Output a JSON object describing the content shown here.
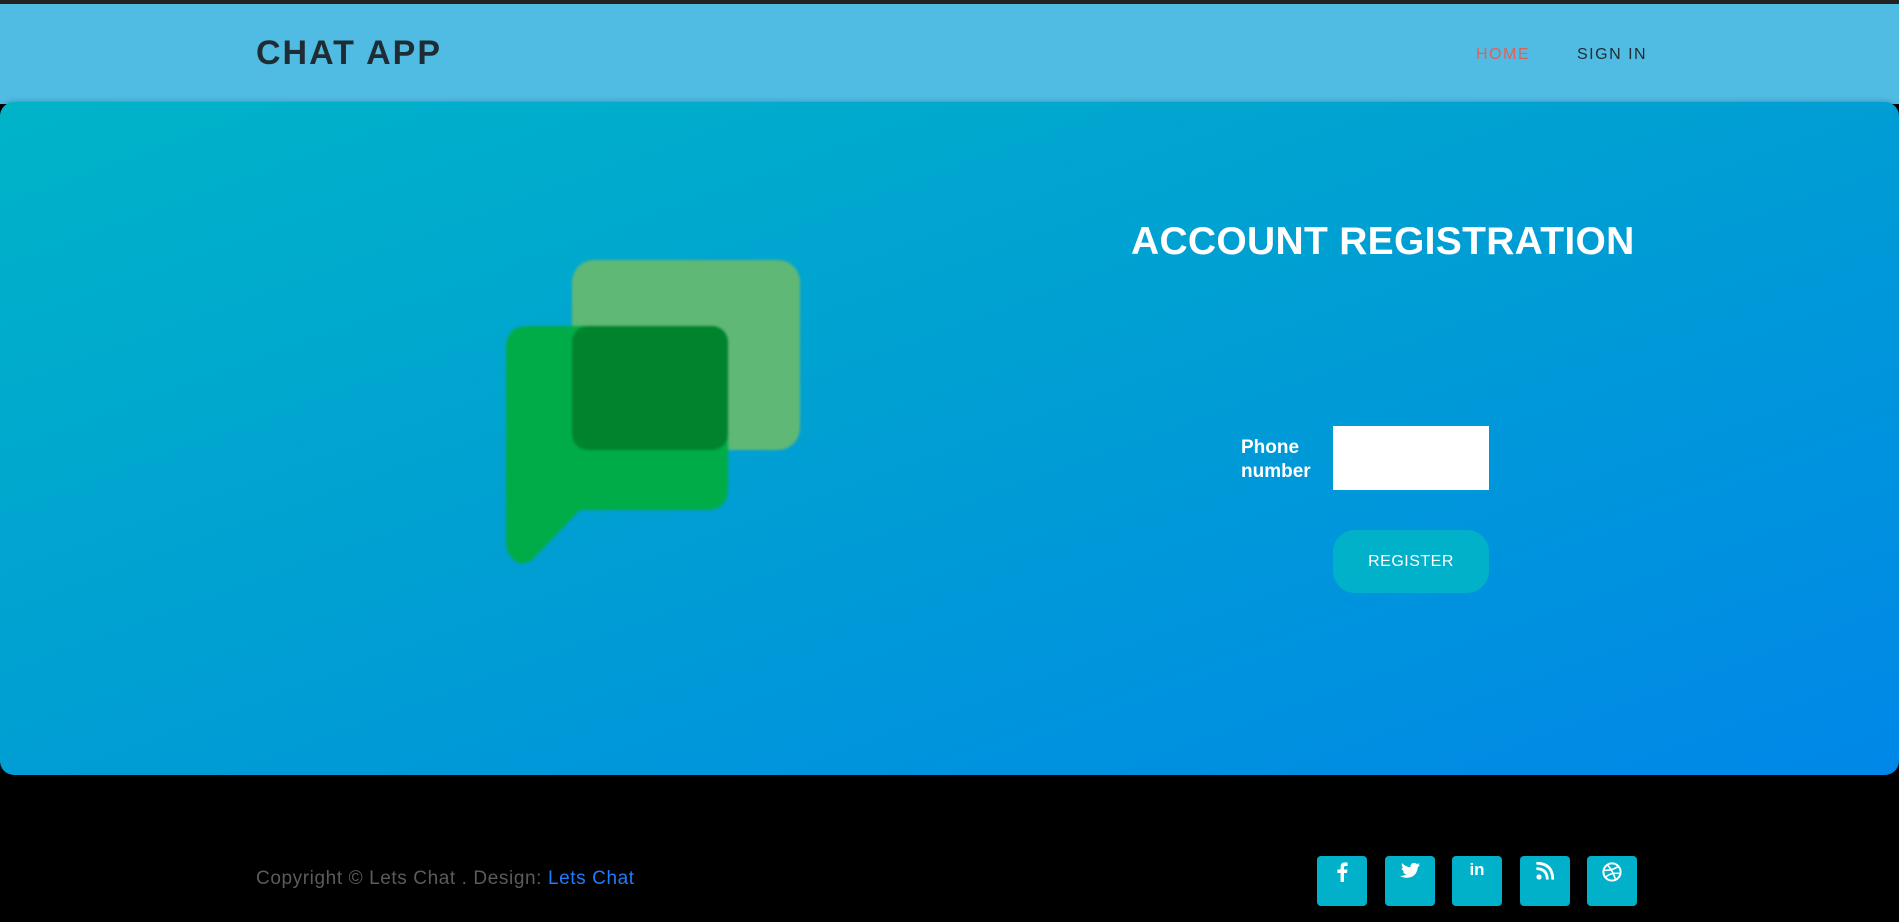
{
  "navbar": {
    "brand": "CHAT APP",
    "links": [
      {
        "label": "HOME",
        "active": true
      },
      {
        "label": "SIGN IN",
        "active": false
      }
    ]
  },
  "hero": {
    "logo": "chat-bubbles-logo",
    "registration_title": "ACCOUNT REGISTRATION",
    "phone_label": "Phone number",
    "phone_value": "",
    "register_label": "REGISTER"
  },
  "footer": {
    "copyright_text": "Copyright © Lets Chat . Design:",
    "design_link": "Lets Chat",
    "social_icons": [
      "facebook-icon",
      "twitter-icon",
      "linkedin-icon",
      "rss-icon",
      "dribbble-icon"
    ]
  },
  "colors": {
    "navbar_bg": "#50bce3",
    "active_link": "#e0615a",
    "button_bg": "#00b1c9",
    "link_blue": "#1e7bff"
  }
}
